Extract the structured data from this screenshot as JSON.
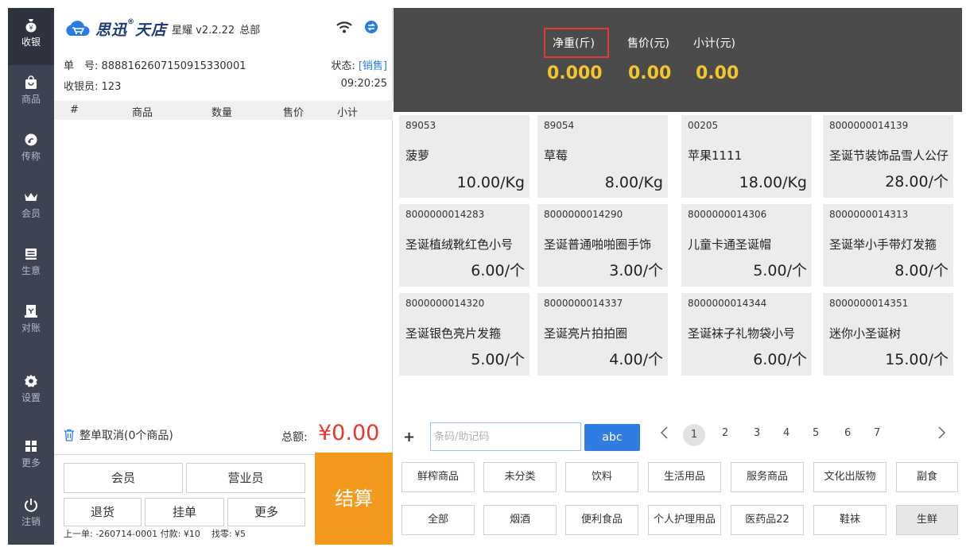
{
  "nav": {
    "items": [
      {
        "label": "收银",
        "icon": "cashier-bag-icon",
        "active": true
      },
      {
        "label": "商品",
        "icon": "shopping-bag-icon",
        "active": false
      },
      {
        "label": "传称",
        "icon": "scale-transfer-icon",
        "active": false
      },
      {
        "label": "会员",
        "icon": "crown-icon",
        "active": false
      },
      {
        "label": "生意",
        "icon": "report-icon",
        "active": false
      },
      {
        "label": "对账",
        "icon": "reconcile-icon",
        "active": false
      },
      {
        "label": "设置",
        "icon": "gear-icon",
        "active": false
      },
      {
        "label": "更多",
        "icon": "grid-icon",
        "active": false
      },
      {
        "label": "注销",
        "icon": "power-icon",
        "active": false
      }
    ]
  },
  "header": {
    "brand_name": "思迅",
    "brand_reg": "®",
    "brand_name2": "天店",
    "version": "星耀 v2.2.22",
    "store": "总部"
  },
  "order": {
    "order_no_label": "单　号:",
    "order_no": "8888162607150915330001",
    "status_label": "状态:",
    "status_value": "[销售]",
    "cashier_label": "收银员:",
    "cashier": "123",
    "time": "09:20:25",
    "columns": [
      "#",
      "商品",
      "数量",
      "售价",
      "小计"
    ],
    "cancel_label": "整单取消(0个商品)",
    "total_label": "总额:",
    "total_value": "¥0.00",
    "buttons": {
      "member": "会员",
      "clerk": "营业员",
      "return": "退货",
      "hold": "挂单",
      "more": "更多",
      "checkout": "结算"
    },
    "last_order": "上一单: -260714-0001 付款: ¥10",
    "change": "找零: ¥5"
  },
  "scale": {
    "weight_label": "净重(斤)",
    "price_label": "售价(元)",
    "subtotal_label": "小计(元)",
    "weight": "0.000",
    "price": "0.00",
    "subtotal": "0.00"
  },
  "products": [
    {
      "code": "89053",
      "name": "菠萝",
      "price": "10.00/Kg"
    },
    {
      "code": "89054",
      "name": "草莓",
      "price": "8.00/Kg"
    },
    {
      "code": "00205",
      "name": "苹果1111",
      "price": "18.00/Kg"
    },
    {
      "code": "8000000014139",
      "name": "圣诞节装饰品雪人公仔",
      "price": "28.00/个"
    },
    {
      "code": "8000000014283",
      "name": "圣诞植绒靴红色小号",
      "price": "6.00/个"
    },
    {
      "code": "8000000014290",
      "name": "圣诞普通啪啪圈手饰",
      "price": "3.00/个"
    },
    {
      "code": "8000000014306",
      "name": "儿童卡通圣诞帽",
      "price": "5.00/个"
    },
    {
      "code": "8000000014313",
      "name": "圣诞举小手带灯发箍",
      "price": "8.00/个"
    },
    {
      "code": "8000000014320",
      "name": "圣诞银色亮片发箍",
      "price": "5.00/个"
    },
    {
      "code": "8000000014337",
      "name": "圣诞亮片拍拍圈",
      "price": "4.00/个"
    },
    {
      "code": "8000000014344",
      "name": "圣诞袜子礼物袋小号",
      "price": "6.00/个"
    },
    {
      "code": "8000000014351",
      "name": "迷你小圣诞树",
      "price": "15.00/个"
    }
  ],
  "search": {
    "plus": "+",
    "placeholder": "条码/助记码",
    "abc": "abc"
  },
  "pager": {
    "pages": [
      "1",
      "2",
      "3",
      "4",
      "5",
      "6",
      "7"
    ],
    "current": "1"
  },
  "categories": {
    "row1": [
      "鲜榨商品",
      "未分类",
      "饮料",
      "生活用品",
      "服务商品",
      "文化出版物",
      "副食"
    ],
    "row2": [
      "全部",
      "烟酒",
      "便利食品",
      "个人护理用品",
      "医药品22",
      "鞋袜",
      "生鲜"
    ],
    "selected": "生鲜"
  },
  "colors": {
    "nav_bg": "#3e4352",
    "accent_blue": "#2f7de1",
    "checkout_orange": "#f39a1e",
    "total_red": "#e8372c",
    "scale_value_yellow": "#f5c62b",
    "scale_bg": "#4b4b4b"
  }
}
